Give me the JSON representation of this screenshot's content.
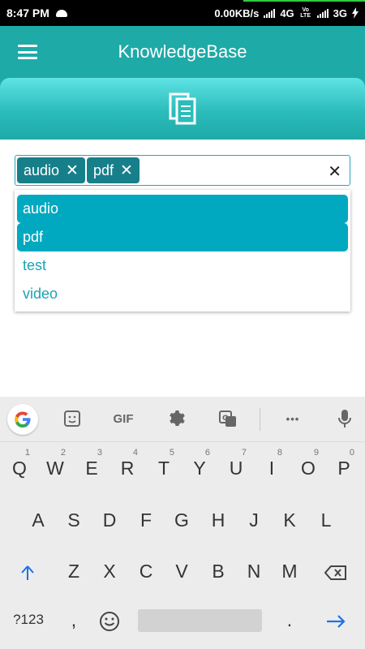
{
  "status_bar": {
    "time": "8:47 PM",
    "speed": "0.00KB/s",
    "net1": "4G",
    "volte": "Vo LTE",
    "net2": "3G"
  },
  "app_bar": {
    "title": "KnowledgeBase",
    "menu_icon": "hamburger-icon"
  },
  "banner": {
    "icon": "document-copy-icon"
  },
  "tag_input": {
    "chips": [
      {
        "label": "audio"
      },
      {
        "label": "pdf"
      }
    ],
    "remove_glyph": "✕",
    "clear_glyph": "✕"
  },
  "dropdown": {
    "options": [
      {
        "label": "audio",
        "selected": true
      },
      {
        "label": "pdf",
        "selected": true
      },
      {
        "label": "test",
        "selected": false
      },
      {
        "label": "video",
        "selected": false
      }
    ]
  },
  "keyboard": {
    "toolbar": {
      "gif": "GIF",
      "more": "•••"
    },
    "row1": [
      {
        "k": "Q",
        "h": "1"
      },
      {
        "k": "W",
        "h": "2"
      },
      {
        "k": "E",
        "h": "3"
      },
      {
        "k": "R",
        "h": "4"
      },
      {
        "k": "T",
        "h": "5"
      },
      {
        "k": "Y",
        "h": "6"
      },
      {
        "k": "U",
        "h": "7"
      },
      {
        "k": "I",
        "h": "8"
      },
      {
        "k": "O",
        "h": "9"
      },
      {
        "k": "P",
        "h": "0"
      }
    ],
    "row2": [
      "A",
      "S",
      "D",
      "F",
      "G",
      "H",
      "J",
      "K",
      "L"
    ],
    "row3": [
      "Z",
      "X",
      "C",
      "V",
      "B",
      "N",
      "M"
    ],
    "symbols": "?123",
    "comma": ",",
    "period": "."
  },
  "colors": {
    "primary": "#1eaaa7",
    "chip": "#167f8a",
    "selected_option": "#00a9bf",
    "option_text": "#1aa3b5",
    "keyboard_bg": "#ececec",
    "accent_blue": "#1a73e8"
  }
}
